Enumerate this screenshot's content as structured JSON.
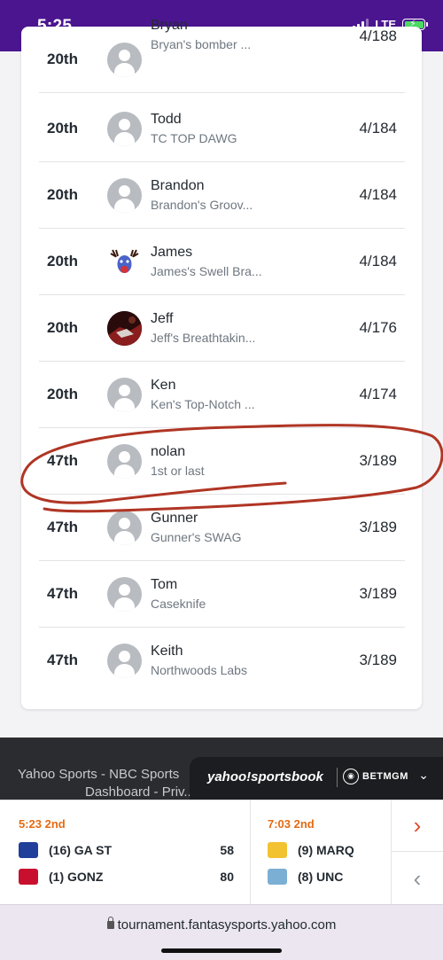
{
  "status_bar": {
    "time": "5:25",
    "network": "LTE"
  },
  "standings": [
    {
      "rank": "20th",
      "name": "Bryan",
      "team": "Bryan's bomber ...",
      "score": "4/188",
      "avatar": "default-avatar"
    },
    {
      "rank": "20th",
      "name": "Todd",
      "team": "TC TOP DAWG",
      "score": "4/184",
      "avatar": "default-avatar"
    },
    {
      "rank": "20th",
      "name": "Brandon",
      "team": "Brandon's Groov...",
      "score": "4/184",
      "avatar": "default-avatar"
    },
    {
      "rank": "20th",
      "name": "James",
      "team": "James's Swell Bra...",
      "score": "4/184",
      "avatar": "deer-mascot-avatar"
    },
    {
      "rank": "20th",
      "name": "Jeff",
      "team": "Jeff's Breathtakin...",
      "score": "4/176",
      "avatar": "photo-avatar"
    },
    {
      "rank": "20th",
      "name": "Ken",
      "team": "Ken's Top-Notch ...",
      "score": "4/174",
      "avatar": "default-avatar"
    },
    {
      "rank": "47th",
      "name": "nolan",
      "team": "1st or last",
      "score": "3/189",
      "avatar": "default-avatar"
    },
    {
      "rank": "47th",
      "name": "Gunner",
      "team": "Gunner's SWAG",
      "score": "3/189",
      "avatar": "default-avatar"
    },
    {
      "rank": "47th",
      "name": "Tom",
      "team": "Caseknife",
      "score": "3/189",
      "avatar": "default-avatar"
    },
    {
      "rank": "47th",
      "name": "Keith",
      "team": "Northwoods Labs",
      "score": "3/189",
      "avatar": "default-avatar"
    }
  ],
  "footer": {
    "link_line1": "Yahoo Sports - NBC Sports",
    "link_line2": "Dashboard - Priv...",
    "sportsbook_logo": "yahoo!sportsbook",
    "betmgm": "BETMGM"
  },
  "scoreboard": [
    {
      "status": "5:23 2nd",
      "teams": [
        {
          "seed_name": "(16) GA ST",
          "score": "58",
          "logo_color": "#1f3f9a"
        },
        {
          "seed_name": "(1) GONZ",
          "score": "80",
          "logo_color": "#c8102e"
        }
      ]
    },
    {
      "status": "7:03 2nd",
      "teams": [
        {
          "seed_name": "(9) MARQ",
          "score": "",
          "logo_color": "#f2c230"
        },
        {
          "seed_name": "(8) UNC",
          "score": "",
          "logo_color": "#7bafd4"
        }
      ]
    }
  ],
  "browser": {
    "url": "tournament.fantasysports.yahoo.com"
  },
  "colors": {
    "status_bar": "#4b1590",
    "accent_time": "#e56b12",
    "annotation": "#b03524"
  }
}
